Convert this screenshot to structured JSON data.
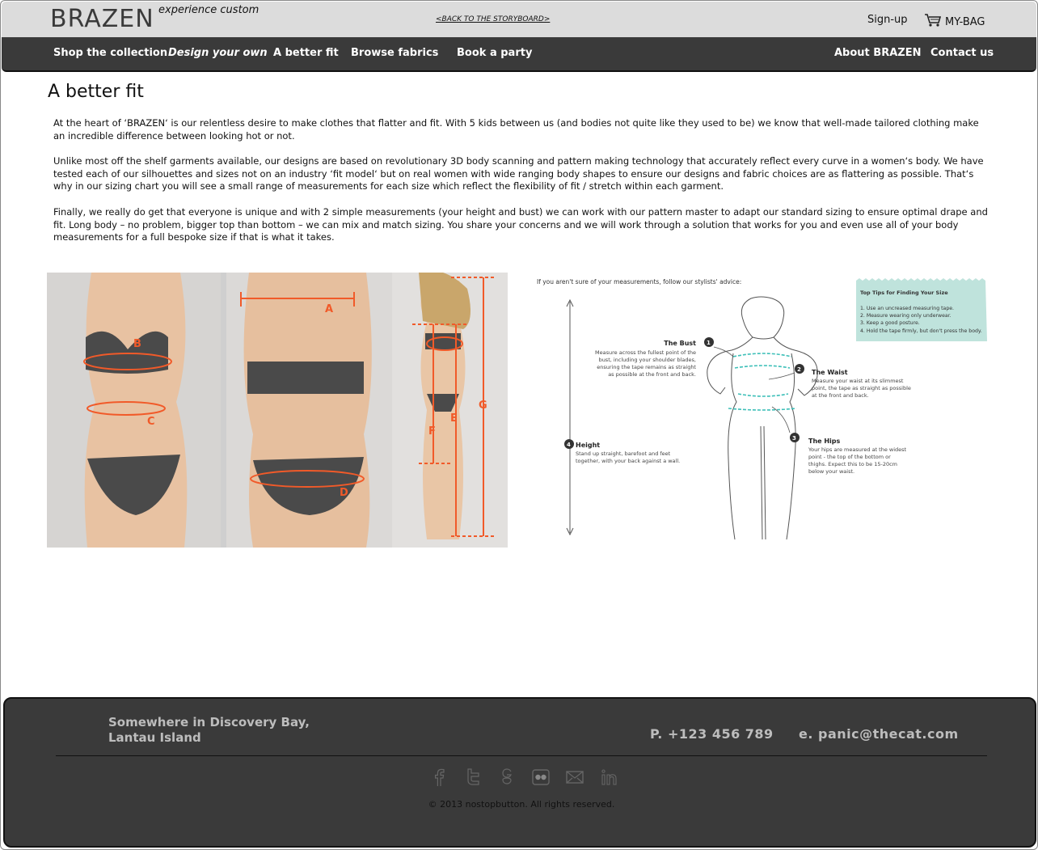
{
  "header": {
    "logo": "BRAZEN",
    "tagline": "experience custom",
    "back_link": "<BACK TO THE STORYBOARD>",
    "signup": "Sign-up",
    "bag": "MY-BAG"
  },
  "nav": {
    "items": [
      "Shop the collection",
      "Design your own",
      "A better fit",
      "Browse fabrics",
      "Book a party"
    ],
    "right_items": [
      "About BRAZEN",
      "Contact us"
    ]
  },
  "page": {
    "title": "A better fit",
    "paragraphs": [
      "At the heart of ‘BRAZEN‘ is our relentless desire to make clothes that flatter and fit. With 5 kids between us (and bodies not quite like they used to be) we know that well-made tailored clothing make an incredible difference between looking hot or not.",
      "Unlike most off the shelf garments available, our designs are based on revolutionary 3D body scanning and pattern making technology that accurately reflect every curve in a women‘s body. We have tested each of our silhouettes and sizes not on an industry ‘fit model‘ but on real women with wide ranging body shapes to ensure our designs and fabric choices are as flattering as possible. That‘s why in our sizing chart you will see a small range of measurements for each size which reflect the flexibility of fit / stretch within each garment.",
      "Finally, we really do get that everyone is unique and with 2 simple measurements (your height and bust) we can work with our pattern master to adapt our standard sizing to ensure optimal drape and fit. Long body – no problem, bigger top than bottom – we can mix and match sizing. You share your concerns and we will work through a solution that works for you and even use all of your body measurements for a full bespoke size if that is what it takes."
    ]
  },
  "photo_labels": [
    "A",
    "B",
    "C",
    "D",
    "E",
    "F",
    "G"
  ],
  "diagram": {
    "intro": "If you aren't sure of your measurements, follow our stylists' advice:",
    "tips_title": "Top Tips for Finding Your Size",
    "tips": [
      "1. Use an uncreased measuring tape.",
      "2. Measure wearing only underwear.",
      "3. Keep a good posture.",
      "4. Hold the tape firmly, but don't press the body."
    ],
    "bust_title": "The Bust",
    "bust_text": [
      "Measure across the fullest point of the",
      "bust, including your shoulder blades,",
      "ensuring the tape remains as straight",
      "as possible at the front and back."
    ],
    "waist_title": "The Waist",
    "waist_text": [
      "Measure your waist at its slimmest",
      "point, the tape as straight as possible",
      "at the front and back."
    ],
    "hips_title": "The Hips",
    "hips_text": [
      "Your hips are measured at the widest",
      "point - the top of the bottom or",
      "thighs. Expect this to be 15-20cm",
      "below your waist."
    ],
    "height_title": "Height",
    "height_text": [
      "Stand up straight, barefoot and feet",
      "together, with your back against a wall."
    ],
    "markers": [
      "1",
      "2",
      "3",
      "4"
    ]
  },
  "footer": {
    "address": "Somewhere in Discovery Bay, Lantau Island",
    "phone": "P. +123 456 789",
    "email": "e. panic@thecat.com",
    "copyright": "© 2013 nostopbutton. All rights reserved.",
    "social_icons": [
      "facebook-icon",
      "twitter-icon",
      "google-plus-icon",
      "flickr-icon",
      "mail-icon",
      "linkedin-icon"
    ]
  },
  "colors": {
    "header_bg": "#dcdcdc",
    "nav_bg": "#3a3a3a",
    "footer_bg": "#3a3a3a",
    "measure_red": "#f15a29",
    "measure_teal": "#3dbfb8",
    "tips_bg": "#bfe3dc"
  }
}
